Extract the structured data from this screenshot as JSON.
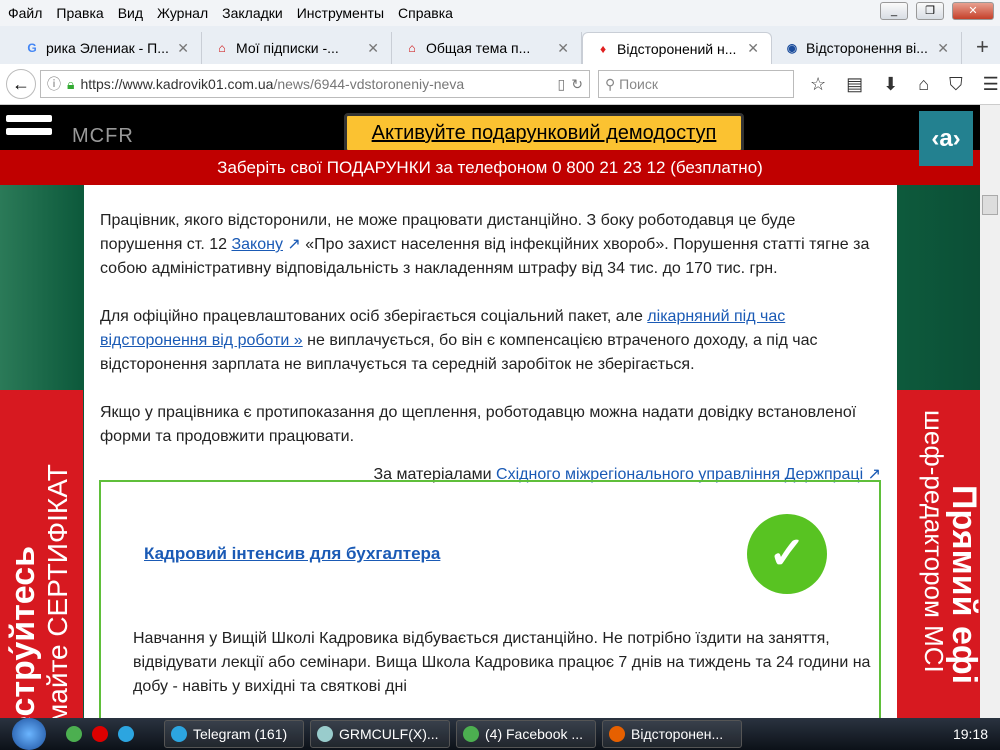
{
  "menu": [
    "Файл",
    "Правка",
    "Вид",
    "Журнал",
    "Закладки",
    "Инструменты",
    "Справка"
  ],
  "tabs": [
    {
      "title": "рика Элениак - П...",
      "icon": "google-icon"
    },
    {
      "title": "Мої підписки -...",
      "icon": "house-icon"
    },
    {
      "title": "Общая тема п...",
      "icon": "house-icon"
    },
    {
      "title": "Відсторонений н...",
      "icon": "flame-icon",
      "active": true
    },
    {
      "title": "Відсторонення ві...",
      "icon": "shield-icon"
    }
  ],
  "nav": {
    "url_host": "https://www.kadrovik01.com.ua",
    "url_path": "/news/6944-vdstoroneniy-neva",
    "search_placeholder": "Поиск"
  },
  "site": {
    "logo": "MCFR",
    "promo": "Активуйте подарунковий демодоступ",
    "a_button": "‹а›",
    "red_bar": "Заберіть свої ПОДАРУНКИ за телефоном 0 800 21 23 12 (безплатно)"
  },
  "article": {
    "p1_a": "Працівник, якого відсторонили, не може працювати дистанційно. З боку роботодавця це буде порушення ст. 12 ",
    "p1_link": "Закону",
    "p1_b": " «Про захист населення від інфекційних хвороб». Порушення статті тягне за собою адміністративну відповідальність з накладенням штрафу від 34 тис. до 170 тис. грн.",
    "p2_a": "Для офіційно працевлаштованих осіб зберігається соціальний пакет, але ",
    "p2_link": "лікарняний під час відсторонення від роботи »",
    "p2_b": " не виплачується, бо він є компенсацією втраченого доходу, а під час відсторонення зарплата не виплачується та середній заробіток не зберігається.",
    "p3": "Якщо у працівника є протипоказання до щеплення, роботодавцю можна надати довідку встановленої форми та продовжити працювати.",
    "source_prefix": "За матеріалами ",
    "source_link": "Східного міжрегіонального управління Держпраці"
  },
  "promo_box": {
    "title": "Кадровий інтенсив для бухгалтера",
    "text": "Навчання у Вищій Школі Кадровика відбувається дистанційно. Не потрібно їздити на заняття, відвідувати лекції або семінари. Вища Школа Кадровика працює 7 днів на тиждень та 24 години на добу - навіть у вихідні та святкові дні"
  },
  "banners": {
    "left_bold": "естру́йтесь",
    "left_light": "майте СЕРТИФІКАТ",
    "right_bold": "Прямий ефі",
    "right_light": "шеф-редактором МСІ"
  },
  "taskbar": {
    "tasks": [
      "Telegram (161)",
      "GRMCULF(X)...",
      "(4) Facebook ...",
      "Відсторонен..."
    ],
    "clock": "19:18"
  }
}
